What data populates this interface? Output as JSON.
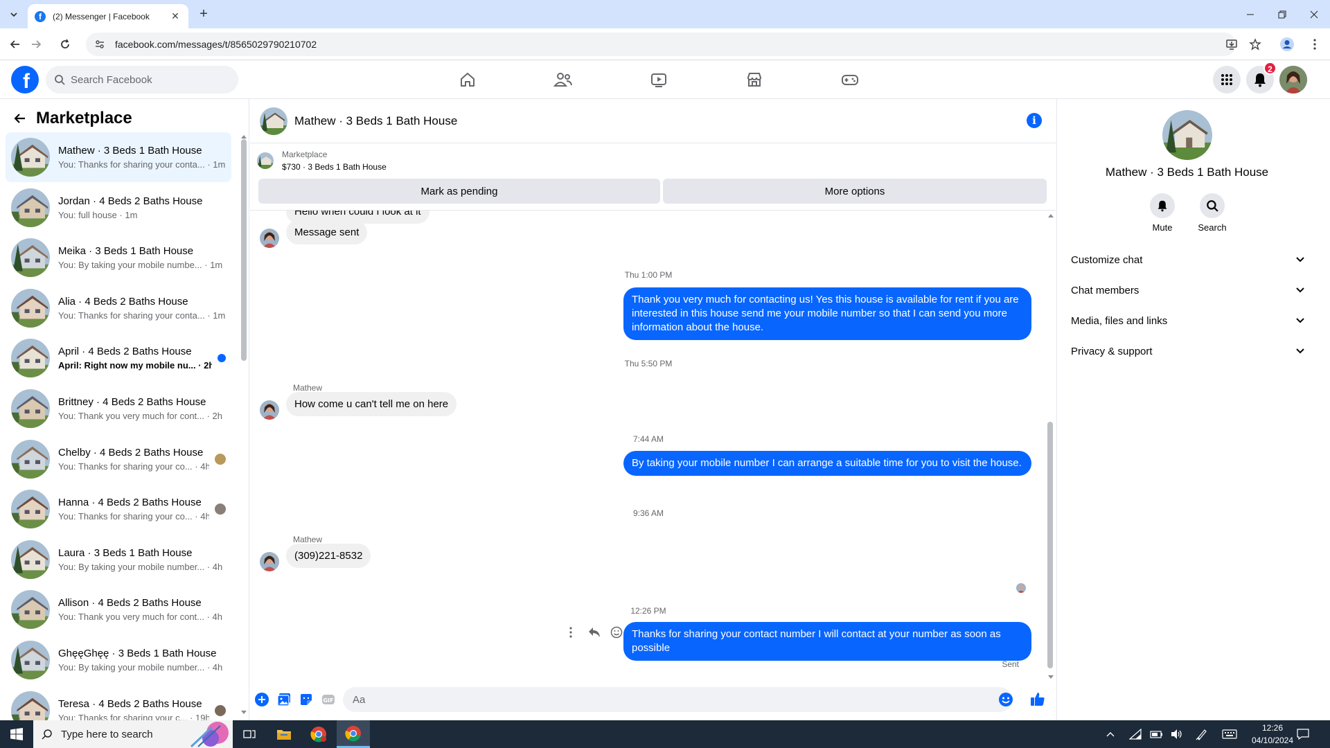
{
  "browser": {
    "tab_title": "(2) Messenger | Facebook",
    "url": "facebook.com/messages/t/8565029790210702"
  },
  "fb": {
    "search_placeholder": "Search Facebook",
    "notification_count": "2"
  },
  "left_panel": {
    "title": "Marketplace",
    "conversations": [
      {
        "name": "Mathew · 3 Beds 1 Bath House",
        "preview": "You: Thanks for sharing your conta... · 1m",
        "active": true
      },
      {
        "name": "Jordan · 4 Beds 2 Baths House",
        "preview": "You: full house · 1m"
      },
      {
        "name": "Meika · 3 Beds 1 Bath House",
        "preview": "You: By taking your mobile numbe... · 1m"
      },
      {
        "name": "Alia · 4 Beds 2 Baths House",
        "preview": "You: Thanks for sharing your conta... · 1m"
      },
      {
        "name": "April · 4 Beds 2 Baths House",
        "preview": "April: Right now my mobile nu... · 2h",
        "unread": true
      },
      {
        "name": "Brittney · 4 Beds 2 Baths House",
        "preview": "You: Thank you very much for cont... · 2h"
      },
      {
        "name": "Chelby · 4 Beds 2 Baths House",
        "preview": "You: Thanks for sharing your co... · 4h"
      },
      {
        "name": "Hanna · 4 Beds 2 Baths House",
        "preview": "You: Thanks for sharing your co... · 4h"
      },
      {
        "name": "Laura · 3 Beds 1 Bath House",
        "preview": "You: By taking your mobile number... · 4h"
      },
      {
        "name": "Allison · 4 Beds 2 Baths House",
        "preview": "You: Thank you very much for cont... · 4h"
      },
      {
        "name": "GhęęGhęę · 3 Beds 1 Bath House",
        "preview": "You: By taking your mobile number... · 4h"
      },
      {
        "name": "Teresa · 4 Beds 2 Baths House",
        "preview": "You: Thanks for sharing your c... · 19h"
      }
    ]
  },
  "chat": {
    "title": "Mathew · 3 Beds 1 Bath House",
    "marketplace_label": "Marketplace",
    "listing": "$730 · 3 Beds 1 Bath House",
    "mark_pending": "Mark as pending",
    "more_options": "More options",
    "partial_message": "Hello when could I look at it",
    "msg_sent": "Message sent",
    "ts1": "Thu 1:00 PM",
    "out1": "Thank you very much for contacting us! Yes this house is available for rent if you are interested in this house send me your mobile number so that I can send you more information about the house.",
    "ts2": "Thu 5:50 PM",
    "sender": "Mathew",
    "in1": "How come u can't tell me on here",
    "ts3": "7:44 AM",
    "out2": "By taking your mobile number I can arrange a suitable time for you to visit the house.",
    "ts4": "9:36 AM",
    "in2": "(309)221-8532",
    "ts5": "12:26 PM",
    "out3": "Thanks for sharing your contact number I will contact at your number as soon as possible",
    "sent_label": "Sent",
    "composer_placeholder": "Aa"
  },
  "right_panel": {
    "name": "Mathew · 3 Beds 1 Bath House",
    "mute": "Mute",
    "search": "Search",
    "sections": [
      "Customize chat",
      "Chat members",
      "Media, files and links",
      "Privacy & support"
    ]
  },
  "taskbar": {
    "search_placeholder": "Type here to search",
    "time": "12:26",
    "date": "04/10/2024"
  },
  "colors": {
    "brand": "#0866ff",
    "active_row": "#ebf5ff",
    "incoming_bubble": "#f0f0f0"
  }
}
